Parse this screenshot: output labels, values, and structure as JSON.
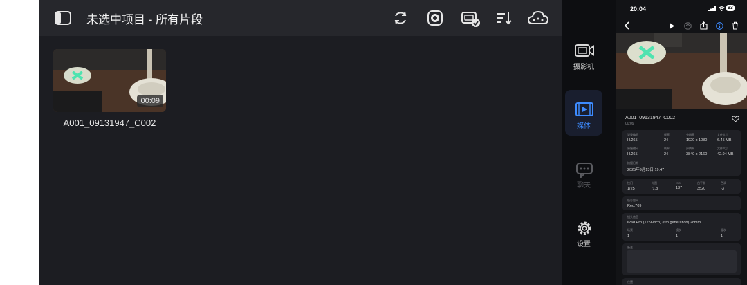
{
  "ipad": {
    "title": "未选中项目 - 所有片段",
    "toolbar_icons": [
      "sidebar-icon",
      "refresh-icon",
      "aperture-icon",
      "camera-check-icon",
      "sort-icon",
      "cloud-icon"
    ],
    "clip": {
      "name": "A001_09131947_C002",
      "duration": "00:09"
    }
  },
  "rail": {
    "items": [
      {
        "label": "摄影机",
        "icon": "camera-icon",
        "active": false
      },
      {
        "label": "媒体",
        "icon": "media-icon",
        "active": true
      },
      {
        "label": "聊天",
        "icon": "chat-icon",
        "active": false
      },
      {
        "label": "设置",
        "icon": "gear-icon",
        "active": false
      }
    ],
    "active_color": "#3d8bff",
    "inactive_color": "#d8d8d8"
  },
  "phone": {
    "time": "20:04",
    "battery": "93",
    "clip_name": "A001_09131947_C002",
    "clip_duration": "00:09",
    "card1": {
      "r1": [
        {
          "label": "记录编码",
          "value": "H.265"
        },
        {
          "label": "帧率",
          "value": "24"
        },
        {
          "label": "分辨率",
          "value": "1920 x 1080"
        },
        {
          "label": "文件大小",
          "value": "6.45 MB"
        }
      ],
      "r2": [
        {
          "label": "原始编码",
          "value": "H.265"
        },
        {
          "label": "帧率",
          "value": "24"
        },
        {
          "label": "分辨率",
          "value": "3840 x 2160"
        },
        {
          "label": "文件大小",
          "value": "42.94 MB"
        }
      ],
      "date_label": "拍摄日期",
      "date_value": "2025年9月13日 19:47"
    },
    "card2": [
      {
        "label": "快门",
        "value": "1/25"
      },
      {
        "label": "光圈",
        "value": "f1.8"
      },
      {
        "label": "ISO",
        "value": "137"
      },
      {
        "label": "白平衡",
        "value": "3520"
      },
      {
        "label": "色调",
        "value": "-3"
      }
    ],
    "card3": {
      "label": "色彩空间",
      "value": "Rec.709"
    },
    "card4": {
      "label": "镜头信息",
      "value": "iPad Pro (12.9-inch) (6th generation) 28mm",
      "sub": [
        {
          "label": "场景",
          "value": "1"
        },
        {
          "label": "镜次",
          "value": "1"
        },
        {
          "label": "摄次",
          "value": "1"
        }
      ]
    },
    "notes_label": "备注",
    "bottom_label": "位置"
  }
}
